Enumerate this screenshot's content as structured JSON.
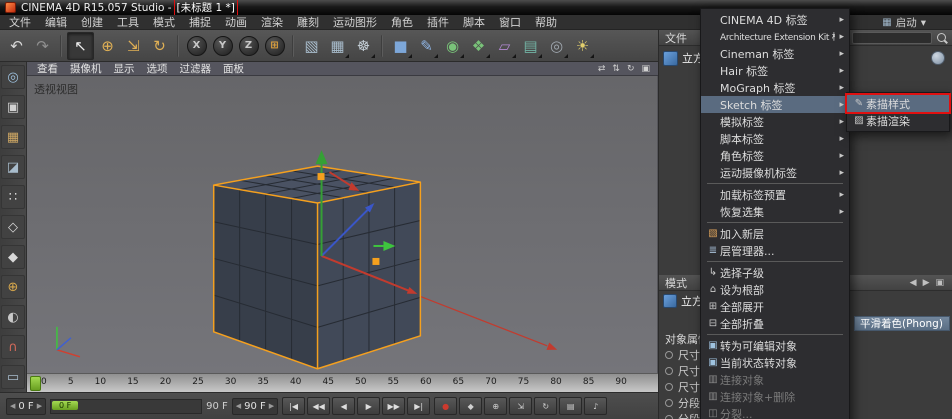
{
  "colors": {
    "selection_orange": "#f5a01e",
    "annotation_red": "#e01010",
    "menu_highlight": "#5a6b80",
    "timeline_marker_green": "#7fb335",
    "axis_x_red": "#c23b2e",
    "axis_y_green": "#35a035",
    "axis_z_blue": "#3a56c8"
  },
  "ui_glyphs": {
    "grid": "▦",
    "dropdown": "▾",
    "spin_left": "◀",
    "spin_right": "▶"
  },
  "titlebar": {
    "title_prefix": "CINEMA 4D R15.057 Studio - ",
    "title_doc": "[未标题 1 *]"
  },
  "menubar": {
    "items": [
      "文件",
      "编辑",
      "创建",
      "工具",
      "模式",
      "捕捉",
      "动画",
      "渲染",
      "雕刻",
      "运动图形",
      "角色",
      "插件",
      "脚本",
      "窗口",
      "帮助"
    ]
  },
  "top_right": {
    "layout_label": "启动"
  },
  "toolbar": {
    "icons": [
      {
        "name": "undo-icon",
        "glyph": "↶",
        "color": "#d8d8d8"
      },
      {
        "name": "redo-icon",
        "glyph": "↷",
        "color": "#8f8f8f"
      },
      {
        "cls": "tsep",
        "clickable": false
      },
      {
        "name": "live-selection-tool",
        "glyph": "↖",
        "color": "#f0f0f0",
        "cls": "pressed"
      },
      {
        "name": "move-tool",
        "glyph": "⊕",
        "color": "#e0b055"
      },
      {
        "name": "scale-tool",
        "glyph": "⇲",
        "color": "#e0b055"
      },
      {
        "name": "rotate-tool",
        "glyph": "↻",
        "color": "#e0b055"
      },
      {
        "cls": "tsep",
        "clickable": false
      },
      {
        "name": "x-axis-lock-button",
        "glyph": "X",
        "cls": "axisbtn"
      },
      {
        "name": "y-axis-lock-button",
        "glyph": "Y",
        "cls": "axisbtn"
      },
      {
        "name": "z-axis-lock-button",
        "glyph": "Z",
        "cls": "axisbtn"
      },
      {
        "name": "coordinate-system-button",
        "glyph": "⊞",
        "color": "#e0a23c",
        "cls": "axisbtn"
      },
      {
        "cls": "tsep",
        "clickable": false
      },
      {
        "name": "render-view-button",
        "glyph": "▧",
        "color": "#a8bccc"
      },
      {
        "name": "render-picture-viewer-button",
        "glyph": "▦",
        "color": "#a8bccc",
        "cls": "dd"
      },
      {
        "name": "render-settings-button",
        "glyph": "☸",
        "color": "#c2ccd4",
        "cls": "dd"
      },
      {
        "cls": "tsep",
        "clickable": false
      },
      {
        "name": "add-cube-button",
        "glyph": "■",
        "color": "#7da7d9",
        "cls": "dd"
      },
      {
        "name": "spline-pen-button",
        "glyph": "✎",
        "color": "#8fb4e3",
        "cls": "dd"
      },
      {
        "name": "subdivision-surface-button",
        "glyph": "◉",
        "color": "#79c379",
        "cls": "dd"
      },
      {
        "name": "array-button",
        "glyph": "❖",
        "color": "#79c379",
        "cls": "dd"
      },
      {
        "name": "deformer-button",
        "glyph": "▱",
        "color": "#b48ad4",
        "cls": "dd"
      },
      {
        "name": "environment-button",
        "glyph": "▤",
        "color": "#72b3a4",
        "cls": "dd"
      },
      {
        "name": "camera-button",
        "glyph": "◎",
        "color": "#a0a8b0",
        "cls": "dd"
      },
      {
        "name": "light-button",
        "glyph": "☀",
        "color": "#e2cf6d",
        "cls": "dd"
      }
    ]
  },
  "left_rail": {
    "icons": [
      {
        "name": "make-editable-icon",
        "glyph": "◎",
        "color": "#9fc3e0"
      },
      {
        "name": "model-mode-icon",
        "glyph": "▣",
        "color": "#d0d0d0"
      },
      {
        "name": "texture-mode-icon",
        "glyph": "▦",
        "color": "#cfa864"
      },
      {
        "name": "workplane-mode-icon",
        "glyph": "◪",
        "color": "#a8bccc"
      },
      {
        "name": "points-mode-icon",
        "glyph": "∷",
        "color": "#d8d8d8"
      },
      {
        "name": "edges-mode-icon",
        "glyph": "◇",
        "color": "#d8d8d8"
      },
      {
        "name": "polygons-mode-icon",
        "glyph": "◆",
        "color": "#d8d8d8"
      },
      {
        "name": "enable-axis-icon",
        "glyph": "⊕",
        "color": "#d8a84c"
      },
      {
        "name": "viewport-solo-icon",
        "glyph": "◐",
        "color": "#c8c8c8"
      },
      {
        "name": "snap-icon",
        "glyph": "∩",
        "color": "#d46a5a"
      },
      {
        "name": "workplane-lock-icon",
        "glyph": "▭",
        "color": "#a8bccc"
      }
    ]
  },
  "viewport": {
    "label": "透视视图",
    "menu_items": [
      "查看",
      "摄像机",
      "显示",
      "选项",
      "过滤器",
      "面板"
    ],
    "corner_icons": [
      {
        "name": "viewport-pan-icon",
        "glyph": "⇄"
      },
      {
        "name": "viewport-zoom-icon",
        "glyph": "⇅"
      },
      {
        "name": "viewport-rotate-icon",
        "glyph": "↻"
      },
      {
        "name": "viewport-toggle-icon",
        "glyph": "▣"
      }
    ]
  },
  "timeline": {
    "ticks": [
      "0",
      "5",
      "10",
      "15",
      "20",
      "25",
      "30",
      "35",
      "40",
      "45",
      "50",
      "55",
      "60",
      "65",
      "70",
      "75",
      "80",
      "85",
      "90"
    ]
  },
  "transport": {
    "current_frame": "0 F",
    "slider_handle": "0 F",
    "end_frame_label": "90 F",
    "range_end": "90 F",
    "buttons": [
      {
        "name": "go-to-start-button",
        "glyph": "|◀"
      },
      {
        "name": "previous-key-button",
        "glyph": "◀◀"
      },
      {
        "name": "play-backwards-button",
        "glyph": "◀"
      },
      {
        "name": "play-button",
        "glyph": "▶"
      },
      {
        "name": "next-key-button",
        "glyph": "▶▶"
      },
      {
        "name": "go-to-end-button",
        "glyph": "▶|"
      }
    ],
    "record_buttons": [
      {
        "name": "record-button",
        "glyph": "●",
        "color": "#cc3a2e"
      },
      {
        "name": "autokey-button",
        "glyph": "◆",
        "color": "#d0d0d0"
      },
      {
        "name": "record-position-button",
        "glyph": "⊕",
        "color": "#d0d0d0"
      },
      {
        "name": "record-scale-button",
        "glyph": "⇲",
        "color": "#d0d0d0"
      },
      {
        "name": "record-rotation-button",
        "glyph": "↻",
        "color": "#d0d0d0"
      },
      {
        "name": "record-parameter-button",
        "glyph": "▤",
        "color": "#d0d0d0"
      },
      {
        "name": "sound-button",
        "glyph": "♪",
        "color": "#d0d0d0"
      }
    ]
  },
  "object_manager": {
    "header": "文件",
    "object_label": "立方体"
  },
  "attribute_manager": {
    "header": "模式",
    "nav_icons": [
      {
        "name": "history-back-icon",
        "glyph": "◀"
      },
      {
        "name": "history-forward-icon",
        "glyph": "▶"
      },
      {
        "name": "lock-icon",
        "glyph": "▣"
      }
    ],
    "title_row": "立方体 对象 [立方体]",
    "phong_label": "平滑着色(Phong)",
    "section_title": "对象属性",
    "params": [
      "尺寸 . X",
      "尺寸 . Y",
      "尺寸 . Z",
      "分段 X",
      "分段 Y"
    ]
  },
  "context_menu": {
    "items": [
      {
        "label": "CINEMA 4D 标签",
        "icon": "",
        "arrow": "▸"
      },
      {
        "label": "Architecture Extension Kit 标签",
        "icon": "",
        "arrow": "▸",
        "cls": "small"
      },
      {
        "label": "Cineman 标签",
        "icon": "",
        "arrow": "▸"
      },
      {
        "label": "Hair 标签",
        "icon": "",
        "arrow": "▸"
      },
      {
        "label": "MoGraph 标签",
        "icon": "",
        "arrow": "▸"
      },
      {
        "label": "Sketch 标签",
        "icon": "",
        "arrow": "▸",
        "cls": "highlighted"
      },
      {
        "label": "模拟标签",
        "icon": "",
        "arrow": "▸"
      },
      {
        "label": "脚本标签",
        "icon": "",
        "arrow": "▸"
      },
      {
        "label": "角色标签",
        "icon": "",
        "arrow": "▸"
      },
      {
        "label": "运动摄像机标签",
        "icon": "",
        "arrow": "▸"
      },
      {
        "cls": "sep",
        "clickable": false
      },
      {
        "label": "加载标签预置",
        "icon": "",
        "arrow": "▸"
      },
      {
        "label": "恢复选集",
        "icon": "",
        "arrow": "▸"
      },
      {
        "cls": "sep",
        "clickable": false
      },
      {
        "label": "加入新层",
        "icon": "▧",
        "iconcolor": "#d9a05a"
      },
      {
        "label": "层管理器...",
        "icon": "≣",
        "iconcolor": "#a8c0d8"
      },
      {
        "cls": "sep",
        "clickable": false
      },
      {
        "label": "选择子级",
        "icon": "↳",
        "iconcolor": "#c8c8c8"
      },
      {
        "label": "设为根部",
        "icon": "⌂",
        "iconcolor": "#c8c8c8"
      },
      {
        "label": "全部展开",
        "icon": "⊞",
        "iconcolor": "#c8c8c8"
      },
      {
        "label": "全部折叠",
        "icon": "⊟",
        "iconcolor": "#c8c8c8"
      },
      {
        "cls": "sep",
        "clickable": false
      },
      {
        "label": "转为可编辑对象",
        "icon": "▣",
        "iconcolor": "#9fc3e0"
      },
      {
        "label": "当前状态转对象",
        "icon": "▣",
        "iconcolor": "#9fc3e0"
      },
      {
        "label": "连接对象",
        "icon": "▥",
        "iconcolor": "#8a8a8a",
        "cls": "disabled",
        "clickable": false
      },
      {
        "label": "连接对象+删除",
        "icon": "▥",
        "iconcolor": "#8a8a8a",
        "cls": "disabled",
        "clickable": false
      },
      {
        "label": "分裂...",
        "icon": "◫",
        "iconcolor": "#8a8a8a",
        "cls": "disabled",
        "clickable": false
      }
    ]
  },
  "submenu": {
    "items": [
      {
        "label": "素描样式",
        "icon": "✎",
        "iconcolor": "#c8c8c8",
        "cls": "highlighted boxed"
      },
      {
        "label": "素描渲染",
        "icon": "▨",
        "iconcolor": "#c8c8c8"
      }
    ]
  }
}
